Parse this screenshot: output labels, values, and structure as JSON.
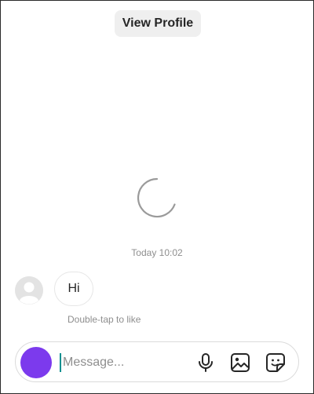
{
  "header": {
    "view_profile_label": "View Profile"
  },
  "thread": {
    "timestamp": "Today 10:02",
    "messages": [
      {
        "text": "Hi"
      }
    ],
    "hint": "Double-tap to like"
  },
  "composer": {
    "placeholder": "Message...",
    "value": "",
    "avatar_color": "#7c3aed",
    "icons": [
      "microphone-icon",
      "gallery-icon",
      "sticker-icon"
    ]
  },
  "colors": {
    "secondary_text": "#8e8e8e",
    "primary_text": "#262626",
    "button_bg": "#efefef"
  }
}
